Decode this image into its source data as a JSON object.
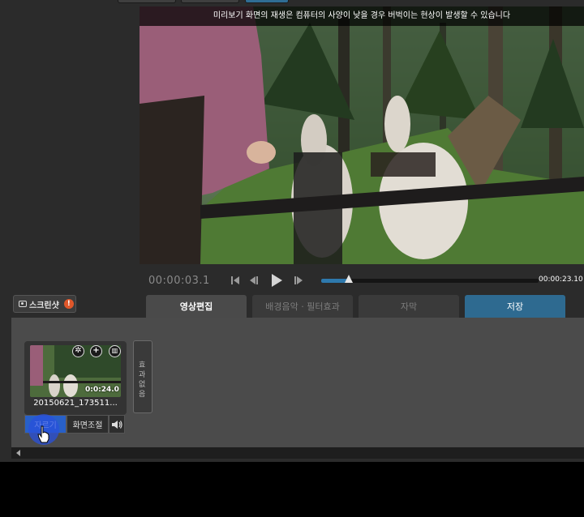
{
  "preview": {
    "notice": "미리보기 화면의 재생은 컴퓨터의 사양이 낮을 경우 버벅이는 현상이 발생할 수 있습니다"
  },
  "player": {
    "current_time": "00:00:03.1",
    "total_time": "00:00:23.10",
    "progress": 0.125,
    "icons": [
      "skip-start-icon",
      "step-back-icon",
      "play-icon",
      "step-forward-icon"
    ]
  },
  "screenshot_button": {
    "label": "스크린샷",
    "info_glyph": "!"
  },
  "tabs": [
    {
      "label": "영상편집",
      "state": "active"
    },
    {
      "label": "배경음악 · 필터효과",
      "state": "inactive"
    },
    {
      "label": "자막",
      "state": "inactive"
    },
    {
      "label": "저장",
      "state": "save"
    }
  ],
  "clip": {
    "name": "20150621_173511...",
    "duration": "0:0:24.0",
    "icons": [
      "settings-icon",
      "add-icon",
      "delete-icon"
    ],
    "buttons": {
      "trim": "자르기",
      "adjust": "화면조절",
      "volume_icon": "speaker-icon"
    }
  },
  "effect_slot": {
    "label": "효과없음"
  },
  "colors": {
    "accent": "#2e6a90",
    "seek": "#2e79ad",
    "highlight": "#2860c8"
  }
}
